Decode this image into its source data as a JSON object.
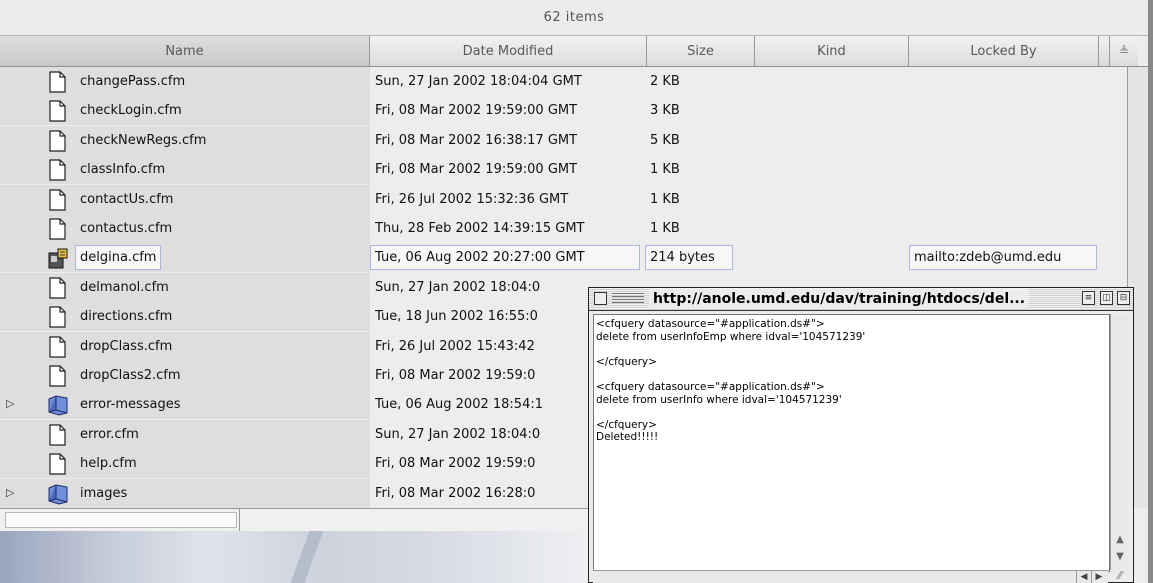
{
  "window": {
    "item_count": "62 items",
    "columns": {
      "name": "Name",
      "date": "Date Modified",
      "size": "Size",
      "kind": "Kind",
      "locked_by": "Locked By",
      "sort_icon": "≜"
    }
  },
  "files": [
    {
      "name": "changePass.cfm",
      "date": "Sun, 27 Jan 2002 18:04:04 GMT",
      "size": "2 KB",
      "locked_by": "",
      "type": "file-icon"
    },
    {
      "name": "checkLogin.cfm",
      "date": "Fri, 08 Mar 2002 19:59:00 GMT",
      "size": "3 KB",
      "locked_by": "",
      "type": "file-icon"
    },
    {
      "name": "checkNewRegs.cfm",
      "date": "Fri, 08 Mar 2002 16:38:17 GMT",
      "size": "5 KB",
      "locked_by": "",
      "type": "file-icon"
    },
    {
      "name": "classInfo.cfm",
      "date": "Fri, 08 Mar 2002 19:59:00 GMT",
      "size": "1 KB",
      "locked_by": "",
      "type": "file-icon"
    },
    {
      "name": "contactUs.cfm",
      "date": "Fri, 26 Jul 2002 15:32:36 GMT",
      "size": "1 KB",
      "locked_by": "",
      "type": "file-icon"
    },
    {
      "name": "contactus.cfm",
      "date": "Thu, 28 Feb 2002 14:39:15 GMT",
      "size": "1 KB",
      "locked_by": "",
      "type": "file-icon"
    },
    {
      "name": "delgina.cfm",
      "date": "Tue, 06 Aug 2002 20:27:00 GMT",
      "size": "214 bytes",
      "locked_by": "mailto:zdeb@umd.edu",
      "type": "locked-file-icon"
    },
    {
      "name": "delmanol.cfm",
      "date": "Sun, 27 Jan 2002 18:04:0",
      "size": "",
      "locked_by": "",
      "type": "file-icon"
    },
    {
      "name": "directions.cfm",
      "date": "Tue, 18 Jun 2002 16:55:0",
      "size": "",
      "locked_by": "",
      "type": "file-icon"
    },
    {
      "name": "dropClass.cfm",
      "date": "Fri, 26 Jul 2002 15:43:42",
      "size": "",
      "locked_by": "",
      "type": "file-icon"
    },
    {
      "name": "dropClass2.cfm",
      "date": "Fri, 08 Mar 2002 19:59:0",
      "size": "",
      "locked_by": "",
      "type": "file-icon"
    },
    {
      "name": "error-messages",
      "date": "Tue, 06 Aug 2002 18:54:1",
      "size": "",
      "locked_by": "",
      "type": "folder-icon"
    },
    {
      "name": "error.cfm",
      "date": "Sun, 27 Jan 2002 18:04:0",
      "size": "",
      "locked_by": "",
      "type": "file-icon"
    },
    {
      "name": "help.cfm",
      "date": "Fri, 08 Mar 2002 19:59:0",
      "size": "",
      "locked_by": "",
      "type": "file-icon"
    },
    {
      "name": "images",
      "date": "Fri, 08 Mar 2002 16:28:0",
      "size": "",
      "locked_by": "",
      "type": "folder-icon"
    }
  ],
  "popup": {
    "title": "http://anole.umd.edu/dav/training/htdocs/del...",
    "content": "<cfquery datasource=\"#application.ds#\">\ndelete from userInfoEmp where idval='104571239'\n\n</cfquery>\n\n<cfquery datasource=\"#application.ds#\">\ndelete from userInfo where idval='104571239'\n\n</cfquery>\nDeleted!!!!!"
  },
  "colors": {
    "name_column_bg": "#dedede",
    "highlight_outline": "#a9b7e0",
    "folder_blue": "#5b7fd1"
  }
}
